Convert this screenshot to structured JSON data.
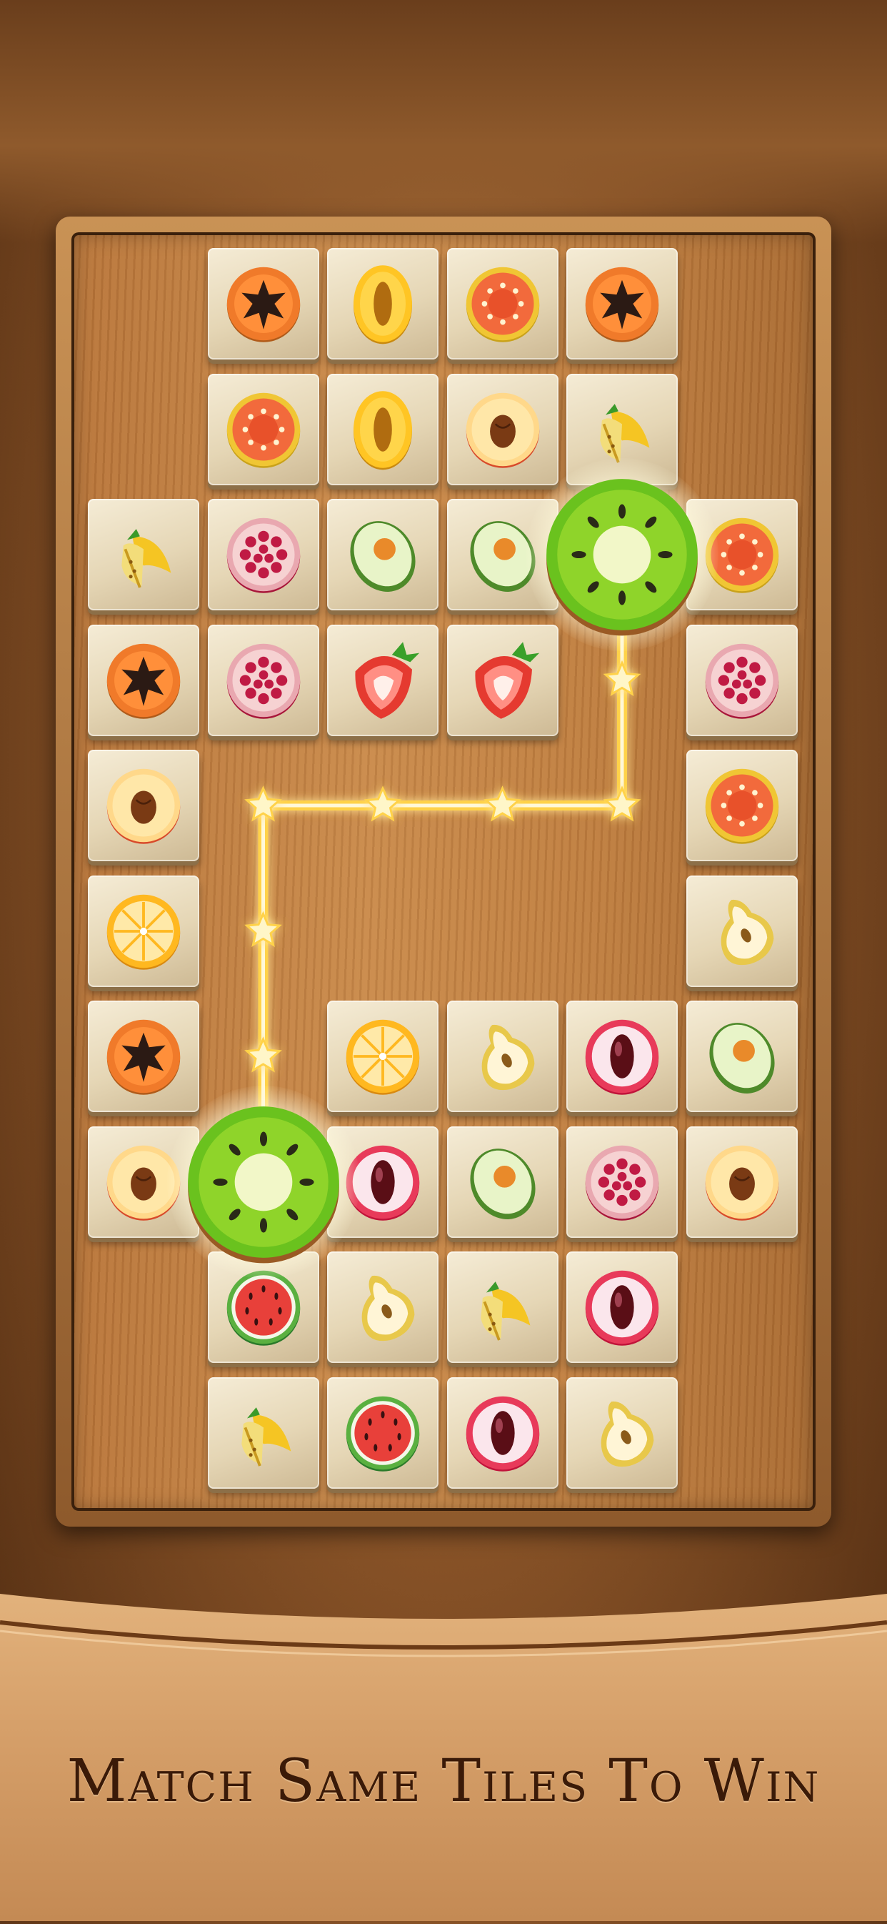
{
  "tagline": "Match Same Tiles To Win",
  "colors": {
    "glow": "#ffd24a",
    "board": "#b8753a",
    "tile": "#efe3c6"
  },
  "tiles": [
    {
      "row": 0,
      "col": 1,
      "fruit": "papaya"
    },
    {
      "row": 0,
      "col": 2,
      "fruit": "melon"
    },
    {
      "row": 0,
      "col": 3,
      "fruit": "guava"
    },
    {
      "row": 0,
      "col": 4,
      "fruit": "papaya"
    },
    {
      "row": 1,
      "col": 1,
      "fruit": "guava"
    },
    {
      "row": 1,
      "col": 2,
      "fruit": "melon"
    },
    {
      "row": 1,
      "col": 3,
      "fruit": "peach"
    },
    {
      "row": 1,
      "col": 4,
      "fruit": "banana"
    },
    {
      "row": 2,
      "col": 0,
      "fruit": "banana"
    },
    {
      "row": 2,
      "col": 1,
      "fruit": "pomegranate"
    },
    {
      "row": 2,
      "col": 2,
      "fruit": "avocado"
    },
    {
      "row": 2,
      "col": 3,
      "fruit": "avocado"
    },
    {
      "row": 2,
      "col": 5,
      "fruit": "guava"
    },
    {
      "row": 3,
      "col": 0,
      "fruit": "papaya"
    },
    {
      "row": 3,
      "col": 1,
      "fruit": "pomegranate"
    },
    {
      "row": 3,
      "col": 2,
      "fruit": "strawberry"
    },
    {
      "row": 3,
      "col": 3,
      "fruit": "strawberry"
    },
    {
      "row": 3,
      "col": 5,
      "fruit": "pomegranate"
    },
    {
      "row": 4,
      "col": 0,
      "fruit": "peach"
    },
    {
      "row": 4,
      "col": 5,
      "fruit": "guava"
    },
    {
      "row": 5,
      "col": 0,
      "fruit": "orange"
    },
    {
      "row": 5,
      "col": 5,
      "fruit": "pear"
    },
    {
      "row": 6,
      "col": 0,
      "fruit": "papaya"
    },
    {
      "row": 6,
      "col": 2,
      "fruit": "orange"
    },
    {
      "row": 6,
      "col": 3,
      "fruit": "pear"
    },
    {
      "row": 6,
      "col": 4,
      "fruit": "lychee"
    },
    {
      "row": 6,
      "col": 5,
      "fruit": "avocado"
    },
    {
      "row": 7,
      "col": 0,
      "fruit": "peach"
    },
    {
      "row": 7,
      "col": 2,
      "fruit": "lychee"
    },
    {
      "row": 7,
      "col": 3,
      "fruit": "avocado"
    },
    {
      "row": 7,
      "col": 4,
      "fruit": "pomegranate"
    },
    {
      "row": 7,
      "col": 5,
      "fruit": "peach"
    },
    {
      "row": 8,
      "col": 1,
      "fruit": "watermelon"
    },
    {
      "row": 8,
      "col": 2,
      "fruit": "pear"
    },
    {
      "row": 8,
      "col": 3,
      "fruit": "banana"
    },
    {
      "row": 8,
      "col": 4,
      "fruit": "lychee"
    },
    {
      "row": 9,
      "col": 1,
      "fruit": "banana"
    },
    {
      "row": 9,
      "col": 2,
      "fruit": "watermelon"
    },
    {
      "row": 9,
      "col": 3,
      "fruit": "lychee"
    },
    {
      "row": 9,
      "col": 4,
      "fruit": "pear"
    }
  ],
  "selected": [
    {
      "row": 2,
      "col": 4,
      "fruit": "kiwi"
    },
    {
      "row": 7,
      "col": 1,
      "fruit": "kiwi"
    }
  ],
  "connection_path": [
    {
      "row": 3,
      "col": 4
    },
    {
      "row": 4,
      "col": 4
    },
    {
      "row": 4,
      "col": 3
    },
    {
      "row": 4,
      "col": 2
    },
    {
      "row": 4,
      "col": 1
    },
    {
      "row": 5,
      "col": 1
    },
    {
      "row": 6,
      "col": 1
    }
  ]
}
